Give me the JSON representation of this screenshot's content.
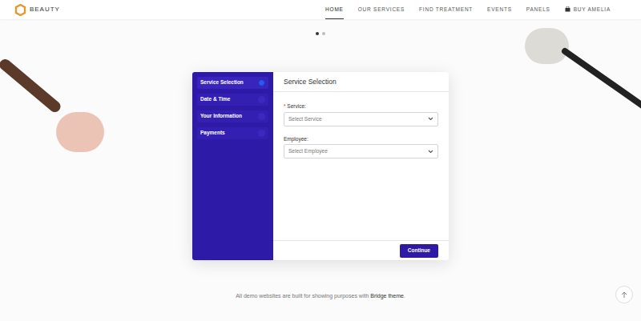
{
  "header": {
    "logo": "BEAUTY",
    "nav": [
      {
        "label": "HOME",
        "selected": true
      },
      {
        "label": "OUR SERVICES",
        "selected": false
      },
      {
        "label": "FIND TREATMENT",
        "selected": false
      },
      {
        "label": "EVENTS",
        "selected": false
      },
      {
        "label": "PANELS",
        "selected": false
      },
      {
        "label": "BUY AMELIA",
        "selected": false
      }
    ]
  },
  "slider_dots": [
    {
      "selected": true
    },
    {
      "selected": false
    }
  ],
  "booking": {
    "steps": [
      {
        "label": "Service Selection",
        "selected": true
      },
      {
        "label": "Date & Time",
        "selected": false
      },
      {
        "label": "Your Information",
        "selected": false
      },
      {
        "label": "Payments",
        "selected": false
      }
    ],
    "title": "Service Selection",
    "required_mark": "*",
    "fields": [
      {
        "label": "Service:",
        "required": true,
        "placeholder": "Select Service"
      },
      {
        "label": "Employee:",
        "required": false,
        "placeholder": "Select Employee"
      }
    ],
    "button": "Continue"
  },
  "footer": {
    "text": "All demo websites are built for showing purposes with ",
    "link": "Bridge theme",
    "end": "."
  }
}
